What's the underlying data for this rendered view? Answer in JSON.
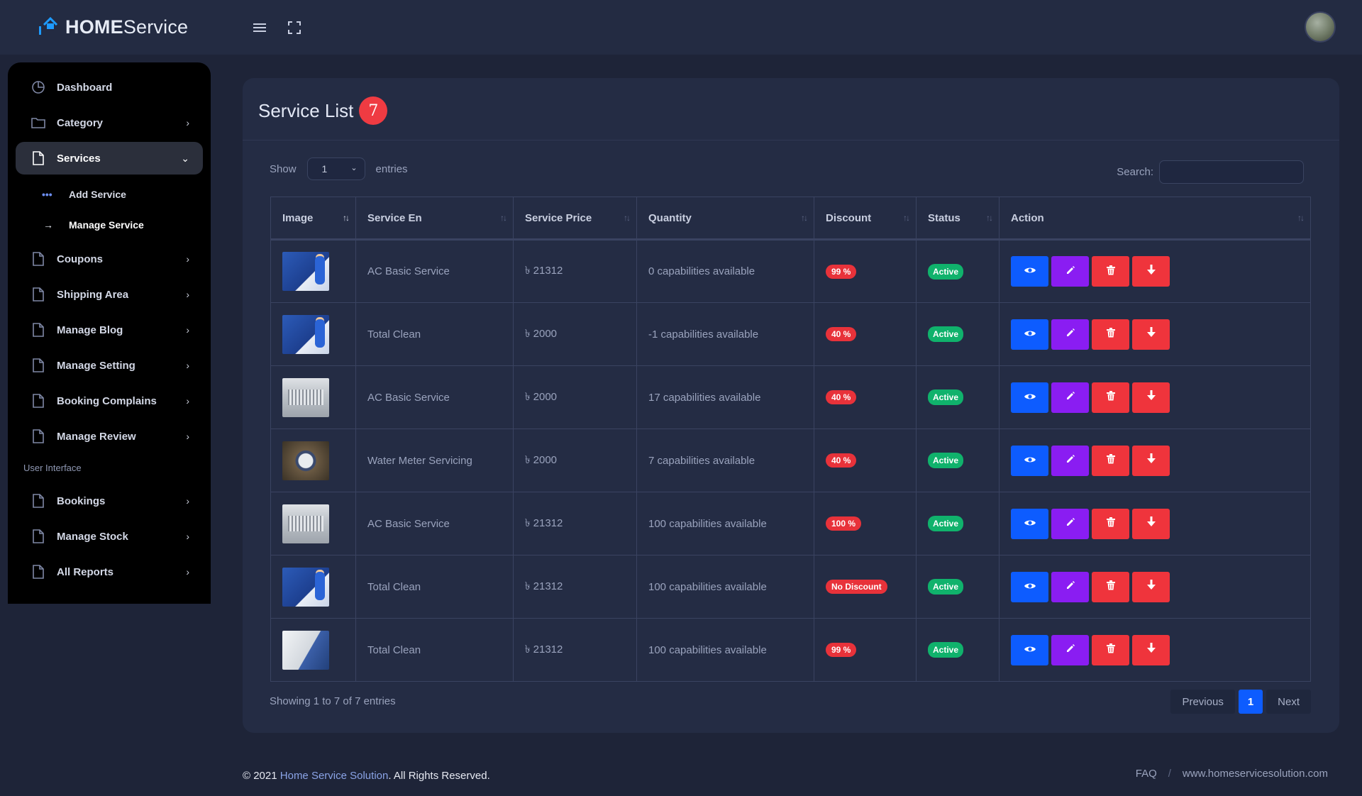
{
  "brand": {
    "bold": "HOME",
    "rest": "Service"
  },
  "colors": {
    "accent": "#0d5cff",
    "badge": "#ef3b42",
    "active": "#10b26c",
    "edit": "#8a1df2",
    "danger": "#ef343c"
  },
  "sidebar": {
    "items": [
      {
        "label": "Dashboard",
        "icon": "pie-chart-icon"
      },
      {
        "label": "Category",
        "icon": "folder-icon"
      },
      {
        "label": "Services",
        "icon": "file-icon"
      },
      {
        "label": "Coupons",
        "icon": "file-icon"
      },
      {
        "label": "Shipping Area",
        "icon": "file-icon"
      },
      {
        "label": "Manage Blog",
        "icon": "file-icon"
      },
      {
        "label": "Manage Setting",
        "icon": "file-icon"
      },
      {
        "label": "Booking Complains",
        "icon": "file-icon"
      },
      {
        "label": "Manage Review",
        "icon": "file-icon"
      },
      {
        "label": "Bookings",
        "icon": "file-icon"
      },
      {
        "label": "Manage Stock",
        "icon": "file-icon"
      },
      {
        "label": "All Reports",
        "icon": "file-icon"
      }
    ],
    "sub_items": [
      {
        "label": "Add Service",
        "icon": "dots-icon"
      },
      {
        "label": "Manage Service",
        "icon": "arrow-right-icon"
      }
    ],
    "section_caption": "User Interface"
  },
  "main": {
    "title": "Service List",
    "count": "7",
    "show_label": "Show",
    "entries_value": "1",
    "entries_label": "entries",
    "search_label": "Search:",
    "search_value": "",
    "columns": [
      "Image",
      "Service En",
      "Service Price",
      "Quantity",
      "Discount",
      "Status",
      "Action"
    ],
    "rows": [
      {
        "thumb": "repair",
        "name": "AC Basic Service",
        "price": "৳ 21312",
        "quantity": "0 capabilities available",
        "discount": "99 %",
        "status": "Active"
      },
      {
        "thumb": "repair",
        "name": "Total Clean",
        "price": "৳ 2000",
        "quantity": "-1 capabilities available",
        "discount": "40 %",
        "status": "Active"
      },
      {
        "thumb": "acunit",
        "name": "AC Basic Service",
        "price": "৳ 2000",
        "quantity": "17 capabilities available",
        "discount": "40 %",
        "status": "Active"
      },
      {
        "thumb": "meter",
        "name": "Water Meter Servicing",
        "price": "৳ 2000",
        "quantity": "7 capabilities available",
        "discount": "40 %",
        "status": "Active"
      },
      {
        "thumb": "acunit",
        "name": "AC Basic Service",
        "price": "৳ 21312",
        "quantity": "100 capabilities available",
        "discount": "100 %",
        "status": "Active"
      },
      {
        "thumb": "repair",
        "name": "Total Clean",
        "price": "৳ 21312",
        "quantity": "100 capabilities available",
        "discount": "No Discount",
        "status": "Active"
      },
      {
        "thumb": "tech",
        "name": "Total Clean",
        "price": "৳ 21312",
        "quantity": "100 capabilities available",
        "discount": "99 %",
        "status": "Active"
      }
    ],
    "showing": "Showing 1 to 7 of 7 entries",
    "pager": {
      "prev": "Previous",
      "current": "1",
      "next": "Next"
    }
  },
  "footer": {
    "copyright": "© 2021",
    "company": "Home Service Solution",
    "rights": ". All Rights Reserved.",
    "faq": "FAQ",
    "sep": "/",
    "site": "www.homeservicesolution.com"
  }
}
